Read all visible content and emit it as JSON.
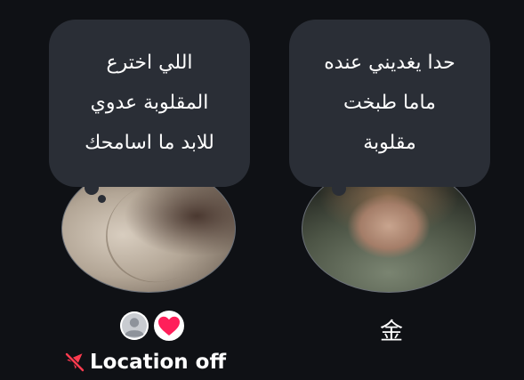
{
  "friends": [
    {
      "id": "left",
      "note_lines": [
        "اللي اخترع",
        "المقلوبة عدوي",
        "للابد ما اسامحك"
      ],
      "status_icons": [
        "default-avatar-icon",
        "heart-icon"
      ],
      "location_text": "Location off",
      "location_icon": "location-off-icon"
    },
    {
      "id": "right",
      "note_lines": [
        "حدا يغديني عنده",
        "ماما طبخت",
        "مقلوبة"
      ],
      "name": "金"
    }
  ],
  "colors": {
    "background": "#0f1115",
    "bubble": "#2a2e36",
    "heart": "#ff1f5a",
    "location_off": "#ff3b4f"
  }
}
